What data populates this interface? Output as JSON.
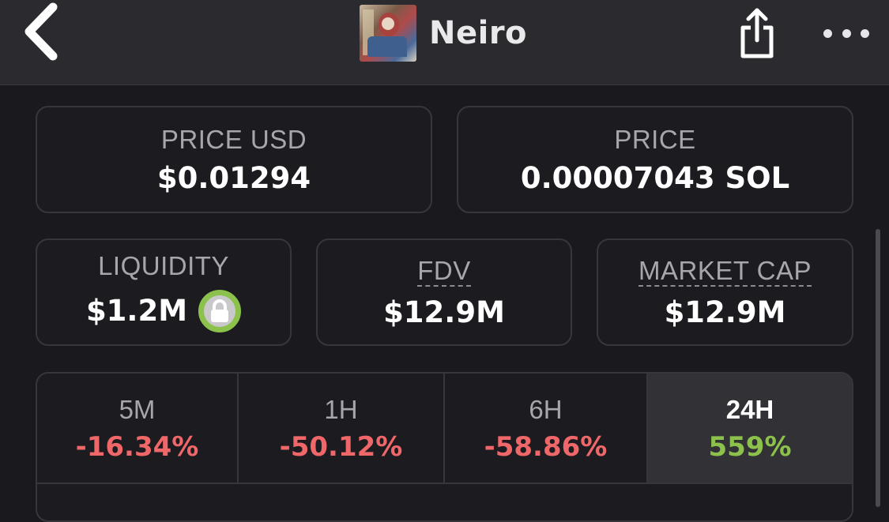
{
  "header": {
    "title": "Neiro",
    "back_icon": "chevron-left-icon",
    "share_icon": "share-icon",
    "more_icon": "more-horizontal-icon"
  },
  "price_usd": {
    "label": "PRICE USD",
    "value": "$0.01294"
  },
  "price_sol": {
    "label": "PRICE",
    "value": "0.00007043 SOL"
  },
  "liquidity": {
    "label": "LIQUIDITY",
    "value": "$1.2M",
    "icon": "lock-icon"
  },
  "fdv": {
    "label": "FDV",
    "value": "$12.9M"
  },
  "market_cap": {
    "label": "MARKET CAP",
    "value": "$12.9M"
  },
  "timeframes": [
    {
      "label": "5M",
      "value": "-16.34%",
      "trend": "negative"
    },
    {
      "label": "1H",
      "value": "-50.12%",
      "trend": "negative"
    },
    {
      "label": "6H",
      "value": "-58.86%",
      "trend": "negative"
    },
    {
      "label": "24H",
      "value": "559%",
      "trend": "positive",
      "selected": true
    }
  ],
  "colors": {
    "negative": "#f0676a",
    "positive": "#8cc14c",
    "background": "#1a1a1e",
    "card_border": "#36363c"
  }
}
